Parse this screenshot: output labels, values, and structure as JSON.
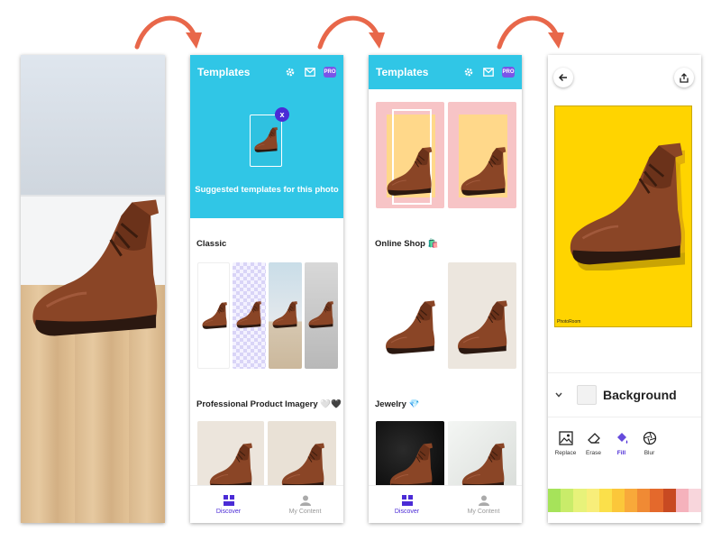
{
  "colors": {
    "header_cyan": "#30c6e6",
    "accent_purple": "#4b2bd6",
    "arrow": "#e8674a",
    "canvas_yellow": "#ffd400"
  },
  "templates_screen": {
    "title": "Templates",
    "header_icons": [
      "gear-icon",
      "mail-icon"
    ],
    "pro_badge": "PRO",
    "suggested_text": "Suggested templates for this photo",
    "close_badge": "x",
    "sections": [
      {
        "title": "Classic",
        "emoji": ""
      },
      {
        "title": "Professional Product Imagery",
        "emoji": "🤍🖤"
      }
    ],
    "nav": [
      {
        "label": "Discover",
        "icon": "discover-icon"
      },
      {
        "label": "My Content",
        "icon": "person-icon"
      }
    ]
  },
  "templates_scrolled": {
    "title": "Templates",
    "pro_badge": "PRO",
    "sections": [
      {
        "title": "Online Shop",
        "emoji": "🛍️"
      },
      {
        "title": "Jewelry",
        "emoji": "💎"
      }
    ],
    "nav": [
      {
        "label": "Discover",
        "icon": "discover-icon"
      },
      {
        "label": "My Content",
        "icon": "person-icon"
      }
    ]
  },
  "editor": {
    "watermark": "PhotoRoom",
    "layer_label": "Background",
    "tools": [
      {
        "label": "Replace",
        "icon": "replace-icon"
      },
      {
        "label": "Erase",
        "icon": "erase-icon"
      },
      {
        "label": "Fill",
        "icon": "fill-icon"
      },
      {
        "label": "Blur",
        "icon": "blur-icon"
      }
    ],
    "swatch_colors": [
      "#a6e35a",
      "#c9ec6a",
      "#e7f27a",
      "#f8ee7a",
      "#fbe04a",
      "#fbc73a",
      "#f8a93a",
      "#f08a34",
      "#e4692c",
      "#c84a22",
      "#f5b2bc",
      "#f8d6dc"
    ]
  }
}
